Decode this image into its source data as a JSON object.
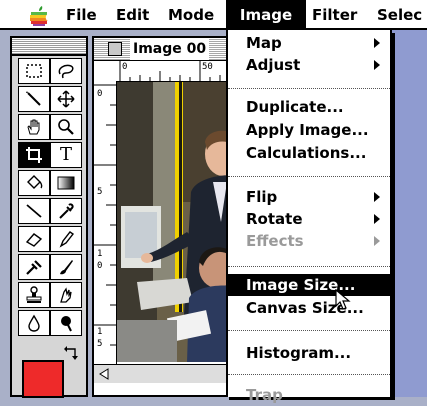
{
  "menubar": {
    "items": [
      {
        "label": "File"
      },
      {
        "label": "Edit"
      },
      {
        "label": "Mode"
      },
      {
        "label": "Image",
        "active": true
      },
      {
        "label": "Filter"
      },
      {
        "label": "Selec"
      }
    ]
  },
  "document": {
    "title": "Image 00",
    "ruler_h": [
      "0",
      "50"
    ],
    "ruler_v": [
      "0",
      "5",
      "1",
      "0",
      "1",
      "5"
    ]
  },
  "image_menu": {
    "items": [
      {
        "label": "Map",
        "submenu": true
      },
      {
        "label": "Adjust",
        "submenu": true
      },
      {
        "label": "Duplicate..."
      },
      {
        "label": "Apply Image..."
      },
      {
        "label": "Calculations..."
      },
      {
        "label": "Flip",
        "submenu": true
      },
      {
        "label": "Rotate",
        "submenu": true
      },
      {
        "label": "Effects",
        "submenu": true,
        "disabled": true
      },
      {
        "label": "Image Size...",
        "highlighted": true
      },
      {
        "label": "Canvas Size..."
      },
      {
        "label": "Histogram..."
      },
      {
        "label": "Trap",
        "disabled": true
      }
    ]
  },
  "toolbox": {
    "foreground_color": "#ee2a2a",
    "tools": [
      "marquee-icon",
      "lasso-icon",
      "magic-wand-icon",
      "move-icon",
      "hand-icon",
      "zoom-icon",
      "crop-icon",
      "type-icon",
      "paint-bucket-icon",
      "gradient-icon",
      "line-icon",
      "eyedropper-icon",
      "eraser-icon",
      "pencil-icon",
      "airbrush-icon",
      "paintbrush-icon",
      "rubber-stamp-icon",
      "smudge-icon",
      "blur-icon",
      "dodge-icon"
    ]
  }
}
